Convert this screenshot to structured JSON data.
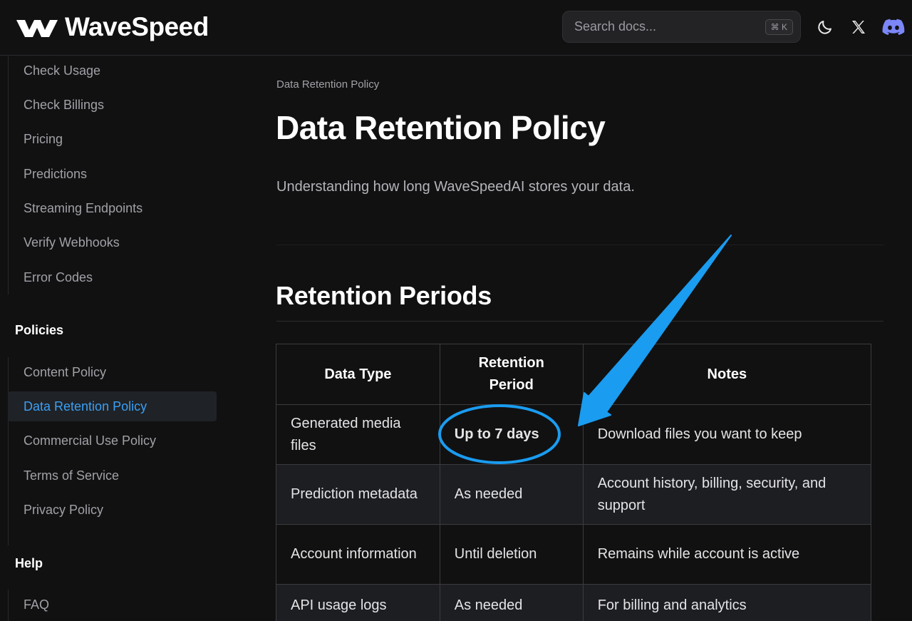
{
  "header": {
    "logo_text": "WaveSpeed",
    "search_placeholder": "Search docs...",
    "search_shortcut": "⌘ K",
    "icons": [
      "moon-icon",
      "x-icon",
      "discord-icon"
    ]
  },
  "sidebar": {
    "items_top": [
      {
        "label": "Check Usage"
      },
      {
        "label": "Check Billings"
      },
      {
        "label": "Pricing"
      },
      {
        "label": "Predictions"
      },
      {
        "label": "Streaming Endpoints"
      },
      {
        "label": "Verify Webhooks"
      },
      {
        "label": "Error Codes"
      }
    ],
    "policies_heading": "Policies",
    "policies": [
      {
        "label": "Content Policy"
      },
      {
        "label": "Data Retention Policy",
        "active": true
      },
      {
        "label": "Commercial Use Policy"
      },
      {
        "label": "Terms of Service"
      },
      {
        "label": "Privacy Policy"
      }
    ],
    "help_heading": "Help",
    "help": [
      {
        "label": "FAQ"
      }
    ]
  },
  "main": {
    "breadcrumb": "Data Retention Policy",
    "title": "Data Retention Policy",
    "subtitle": "Understanding how long WaveSpeedAI stores your data.",
    "section_title": "Retention Periods",
    "table": {
      "headers": [
        "Data Type",
        "Retention Period",
        "Notes"
      ],
      "rows": [
        [
          "Generated media files",
          "Up to 7 days",
          "Download files you want to keep"
        ],
        [
          "Prediction metadata",
          "As needed",
          "Account history, billing, security, and support"
        ],
        [
          "Account information",
          "Until deletion",
          "Remains while account is active"
        ],
        [
          "API usage logs",
          "As needed",
          "For billing and analytics"
        ]
      ]
    }
  },
  "annotation": {
    "color": "#1a9cf0",
    "highlighted_cell": "Up to 7 days"
  },
  "colors": {
    "background": "#111112",
    "accent": "#3b9ff5",
    "active_bg": "#1f2226"
  }
}
